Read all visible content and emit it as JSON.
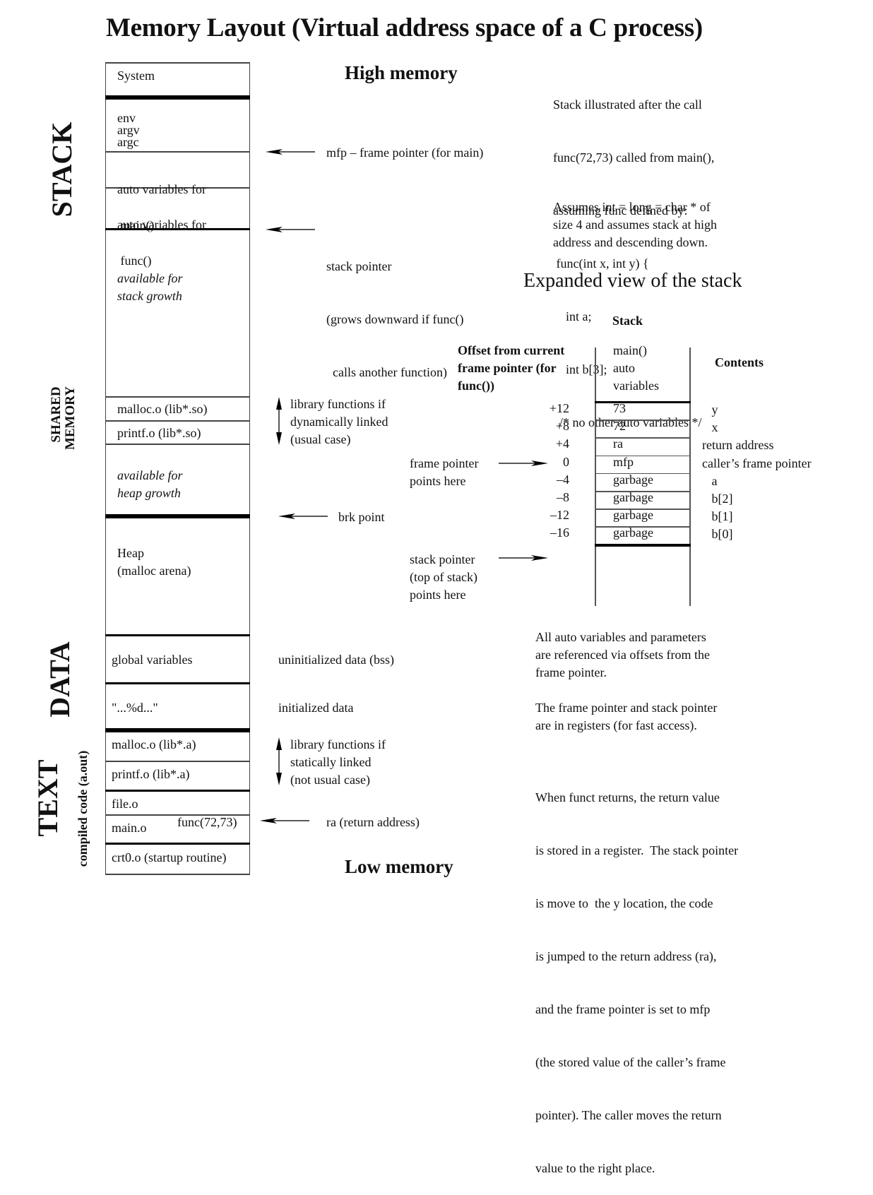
{
  "title": "Memory Layout  (Virtual address space of a C process)",
  "high_memory": "High memory",
  "low_memory": "Low memory",
  "section_labels": {
    "stack": "STACK",
    "shared_memory": [
      "SHARED",
      "MEMORY"
    ],
    "data": "DATA",
    "text": "TEXT",
    "text_sub": "compiled code (a.out)"
  },
  "segments": {
    "system": "System",
    "env_lines": [
      "env",
      "argv",
      "argc"
    ],
    "auto_main": [
      "auto variables for",
      " main()"
    ],
    "auto_func": [
      "auto variables for",
      " func()"
    ],
    "stack_growth": [
      "available for",
      "stack growth"
    ],
    "malloc_so": "malloc.o (lib*.so)",
    "printf_so": "printf.o (lib*.so)",
    "heap_growth": [
      "available for",
      "heap growth"
    ],
    "heap": [
      "Heap",
      "(malloc arena)"
    ],
    "global_vars": "global variables",
    "format_str": "\"...%d...\"",
    "malloc_a": "malloc.o (lib*.a)",
    "printf_a": "printf.o (lib*.a)",
    "file_o": "file.o",
    "main_o": "main.o",
    "func_call": "func(72,73)",
    "crt0": "crt0.o (startup routine)"
  },
  "annotations": {
    "mfp": "mfp – frame pointer (for main)",
    "stack_pointer": [
      "stack pointer",
      "(grows downward if func()",
      "  calls another function)"
    ],
    "dyn_lib": [
      "library functions if",
      "dynamically linked",
      "(usual case)"
    ],
    "brk": "brk point",
    "bss": "uninitialized data (bss)",
    "init_data": "initialized data",
    "static_lib": [
      "library functions if",
      "statically linked",
      "(not usual case)"
    ],
    "ra": "ra (return address)"
  },
  "notes": {
    "intro": [
      "Stack illustrated after the call",
      "func(72,73) called from main(),",
      "assuming func defined by:",
      " func(int x, int y) {",
      "    int a;",
      "    int b[3];",
      "  /* no other auto variables */"
    ],
    "assumes": [
      "Assumes int = long = char * of",
      "size 4 and assumes stack at high",
      "address and descending down."
    ],
    "auto_vars": [
      "All auto variables and parameters",
      "are referenced via offsets from the",
      "frame pointer."
    ],
    "registers": [
      "The frame pointer and stack pointer",
      "are in registers (for fast access)."
    ],
    "returns": [
      "When funct returns, the return value",
      "is stored in a register.  The stack pointer",
      "is move to  the y location, the code",
      "is jumped to the return address (ra),",
      "and the frame pointer is set to mfp",
      "(the stored value of the caller’s frame",
      "pointer). The caller moves the return",
      "value to the right place."
    ]
  },
  "expanded": {
    "heading": "Expanded view of the stack",
    "stack_header": "Stack",
    "offset_header": [
      "Offset from current",
      "frame pointer (for",
      "func())"
    ],
    "contents_header": "Contents",
    "main_auto": [
      "main()",
      "auto",
      "variables"
    ],
    "rows": [
      {
        "offset": "+12",
        "value": "73",
        "content": "   y"
      },
      {
        "offset": "+8",
        "value": "72",
        "content": "   x"
      },
      {
        "offset": "+4",
        "value": "ra",
        "content": "return address"
      },
      {
        "offset": "0",
        "value": "mfp",
        "content": "caller’s frame pointer"
      },
      {
        "offset": "–4",
        "value": "garbage",
        "content": "   a"
      },
      {
        "offset": "–8",
        "value": "garbage",
        "content": "   b[2]"
      },
      {
        "offset": "–12",
        "value": "garbage",
        "content": "   b[1]"
      },
      {
        "offset": "–16",
        "value": "garbage",
        "content": "   b[0]"
      }
    ],
    "fp_label": [
      "frame pointer",
      "points here"
    ],
    "sp_label": [
      "stack pointer",
      "(top of stack)",
      "points here"
    ]
  }
}
